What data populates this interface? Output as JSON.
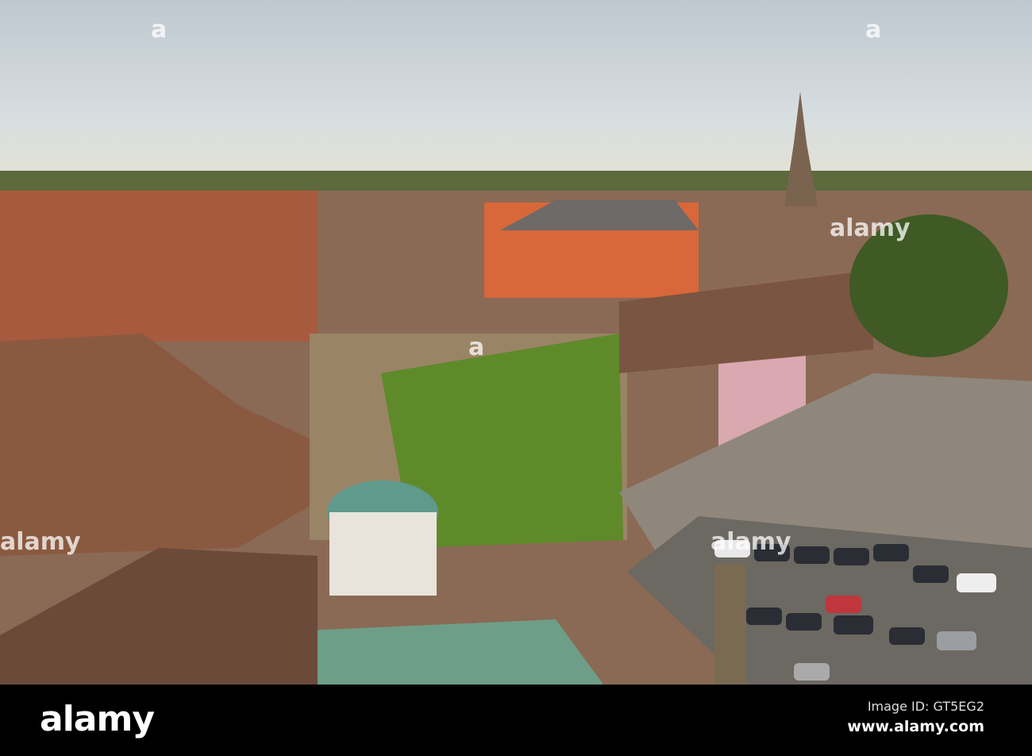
{
  "photo": {
    "subject": "town-rooftops-square-cathedral-spire"
  },
  "watermark": {
    "text": "alamy",
    "repeat": "a"
  },
  "footer": {
    "logo": "alamy",
    "image_id": "Image ID: GT5EG2",
    "url": "www.alamy.com"
  },
  "colors": {
    "sky": "#cdd6dc",
    "roof": "#9a5a3c",
    "brick": "#d8673a",
    "ivy": "#5f8a2a",
    "tarmac": "#77726c"
  }
}
